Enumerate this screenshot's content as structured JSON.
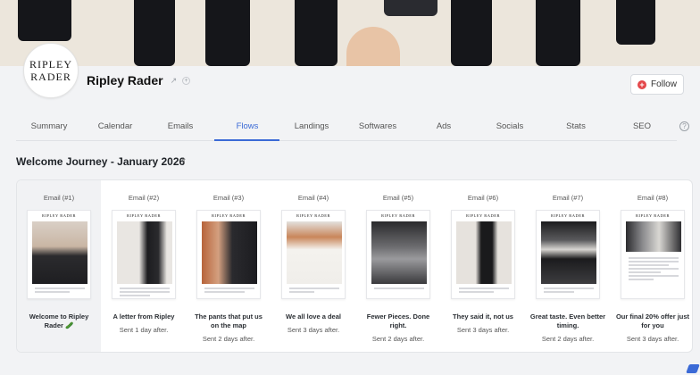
{
  "brand": {
    "name": "Ripley Rader",
    "avatar_line1": "RIPLEY",
    "avatar_line2": "RADER",
    "follow_label": "Follow",
    "thumb_logo": "RIPLEY RADER"
  },
  "tabs": [
    "Summary",
    "Calendar",
    "Emails",
    "Flows",
    "Landings",
    "Softwares",
    "Ads",
    "Socials",
    "Stats",
    "SEO"
  ],
  "active_tab": "Flows",
  "flow": {
    "title": "Welcome Journey - January 2026"
  },
  "emails": [
    {
      "label": "Email (#1)",
      "title": "Welcome to Ripley Rader 🥒",
      "timing": ""
    },
    {
      "label": "Email (#2)",
      "title": "A letter from Ripley",
      "timing": "Sent 1 day after."
    },
    {
      "label": "Email (#3)",
      "title": "The pants that put us on the map",
      "timing": "Sent 2 days after."
    },
    {
      "label": "Email (#4)",
      "title": "We all love a deal",
      "timing": "Sent 3 days after."
    },
    {
      "label": "Email (#5)",
      "title": "Fewer Pieces. Done right.",
      "timing": "Sent 2 days after."
    },
    {
      "label": "Email (#6)",
      "title": "They said it, not us",
      "timing": "Sent 3 days after."
    },
    {
      "label": "Email (#7)",
      "title": "Great taste. Even better timing.",
      "timing": "Sent 2 days after."
    },
    {
      "label": "Email (#8)",
      "title": "Our final 20% offer just for you",
      "timing": "Sent 3 days after."
    }
  ],
  "colors": {
    "accent": "#3b6ad6",
    "follow_icon": "#e4474a",
    "banner_dark": "#15161a"
  }
}
